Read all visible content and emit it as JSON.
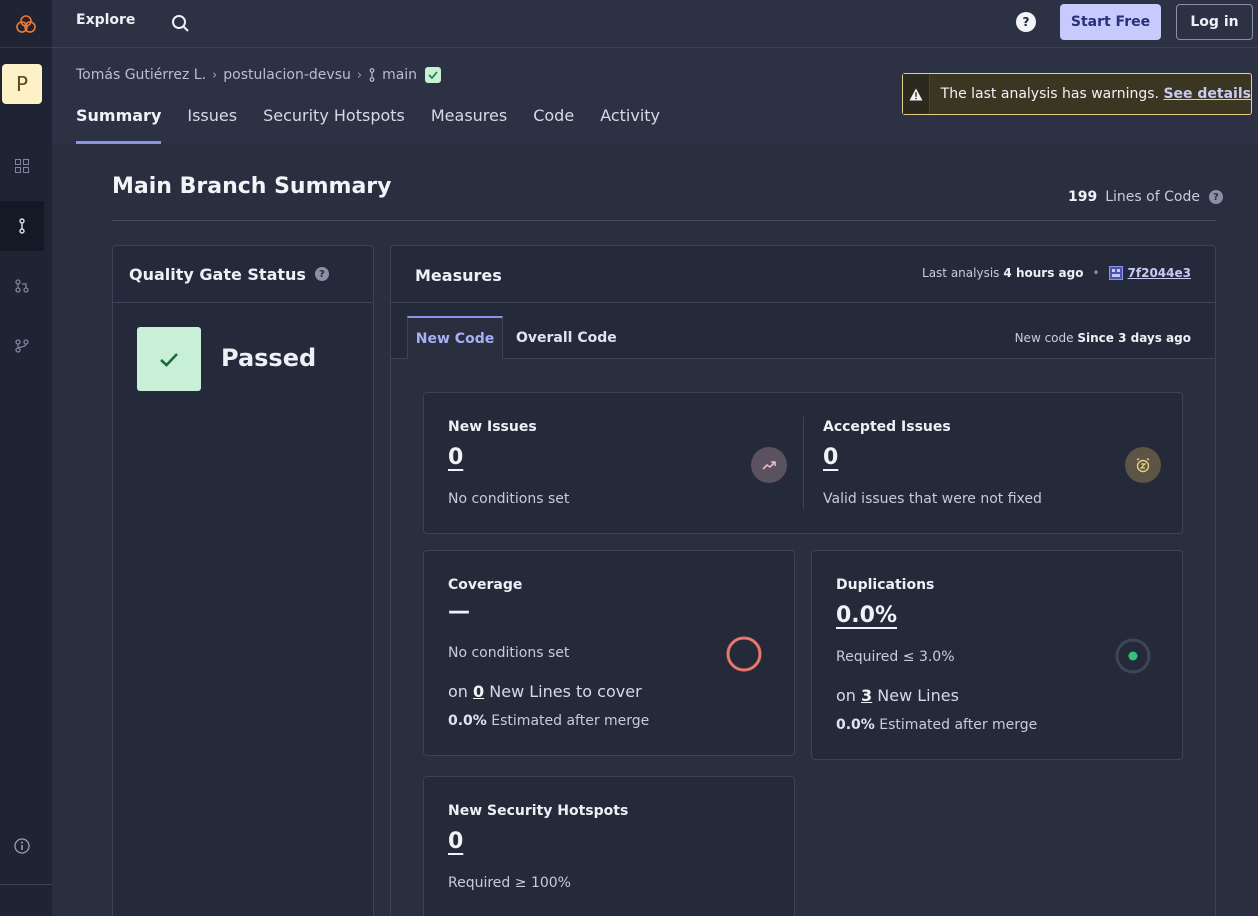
{
  "nav": {
    "explore": "Explore",
    "start_free": "Start Free",
    "log_in": "Log in",
    "help": "?"
  },
  "rail": {
    "project_initial": "P"
  },
  "breadcrumb": {
    "owner": "Tomás Gutiérrez L.",
    "project": "postulacion-devsu",
    "branch": "main"
  },
  "tabs": [
    "Summary",
    "Issues",
    "Security Hotspots",
    "Measures",
    "Code",
    "Activity"
  ],
  "warning": {
    "text": "The last analysis has warnings.",
    "link": "See details"
  },
  "summary": {
    "title": "Main Branch Summary",
    "lines_of_code": "199",
    "lines_label": "Lines of Code"
  },
  "quality_gate": {
    "title": "Quality Gate Status",
    "status": "Passed"
  },
  "measures": {
    "title": "Measures",
    "last_analysis_label": "Last analysis",
    "last_analysis_value": "4 hours ago",
    "commit": "7f2044e3",
    "tab_new": "New Code",
    "tab_overall": "Overall Code",
    "new_code_label": "New code",
    "new_code_value": "Since 3 days ago"
  },
  "cards": {
    "new_issues": {
      "label": "New Issues",
      "value": "0",
      "sub": "No conditions set"
    },
    "accepted_issues": {
      "label": "Accepted Issues",
      "value": "0",
      "sub": "Valid issues that were not fixed"
    },
    "coverage": {
      "label": "Coverage",
      "value": "—",
      "sub": "No conditions set",
      "on": "on",
      "lines_value": "0",
      "lines_label": "New Lines to cover",
      "est_value": "0.0%",
      "est_label": "Estimated after merge"
    },
    "duplications": {
      "label": "Duplications",
      "value": "0.0%",
      "sub": "Required ≤ 3.0%",
      "on": "on",
      "lines_value": "3",
      "lines_label": "New Lines",
      "est_value": "0.0%",
      "est_label": "Estimated after merge"
    },
    "hotspots": {
      "label": "New Security Hotspots",
      "value": "0",
      "sub": "Required ≥ 100%"
    }
  },
  "colors": {
    "accent": "#8c93e8",
    "pass": "#c7f0d6",
    "coverage_ring": "#e8766b",
    "dup_dot": "#35c27a"
  }
}
